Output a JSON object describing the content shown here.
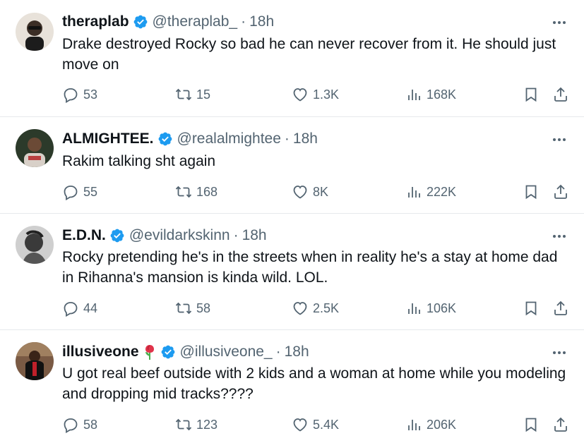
{
  "tweets": [
    {
      "name": "theraplab",
      "handle": "@theraplab_",
      "sep": "·",
      "time": "18h",
      "text": "Drake destroyed Rocky so bad he can never recover from it. He should just move on",
      "replies": "53",
      "reposts": "15",
      "likes": "1.3K",
      "views": "168K",
      "avatar_color": "#e8e2da",
      "has_emoji": false
    },
    {
      "name": "ALMIGHTEE.",
      "handle": "@realalmightee",
      "sep": "·",
      "time": "18h",
      "text": "Rakim talking sht again",
      "replies": "55",
      "reposts": "168",
      "likes": "8K",
      "views": "222K",
      "avatar_color": "#2c3a2a",
      "has_emoji": false
    },
    {
      "name": "E.D.N.",
      "handle": "@evildarkskinn",
      "sep": "·",
      "time": "18h",
      "text": "Rocky pretending he's in the streets when in reality he's a stay at home dad in Rihanna's mansion is kinda wild. LOL.",
      "replies": "44",
      "reposts": "58",
      "likes": "2.5K",
      "views": "106K",
      "avatar_color": "#8a8a8a",
      "has_emoji": false
    },
    {
      "name": "illusiveone",
      "handle": "@illusiveone_",
      "sep": "·",
      "time": "18h",
      "text": "U got real beef outside with 2 kids and a woman at home while you modeling and dropping mid tracks????",
      "replies": "58",
      "reposts": "123",
      "likes": "5.4K",
      "views": "206K",
      "avatar_color": "#5a3a2a",
      "has_emoji": true
    }
  ],
  "colors": {
    "text": "#0f1419",
    "muted": "#536471",
    "verified": "#1d9bf0",
    "divider": "#e6e9ec"
  },
  "icons": [
    "verified-badge-icon",
    "more-icon",
    "reply-icon",
    "repost-icon",
    "like-icon",
    "views-icon",
    "bookmark-icon",
    "share-icon",
    "rose-emoji-icon"
  ]
}
